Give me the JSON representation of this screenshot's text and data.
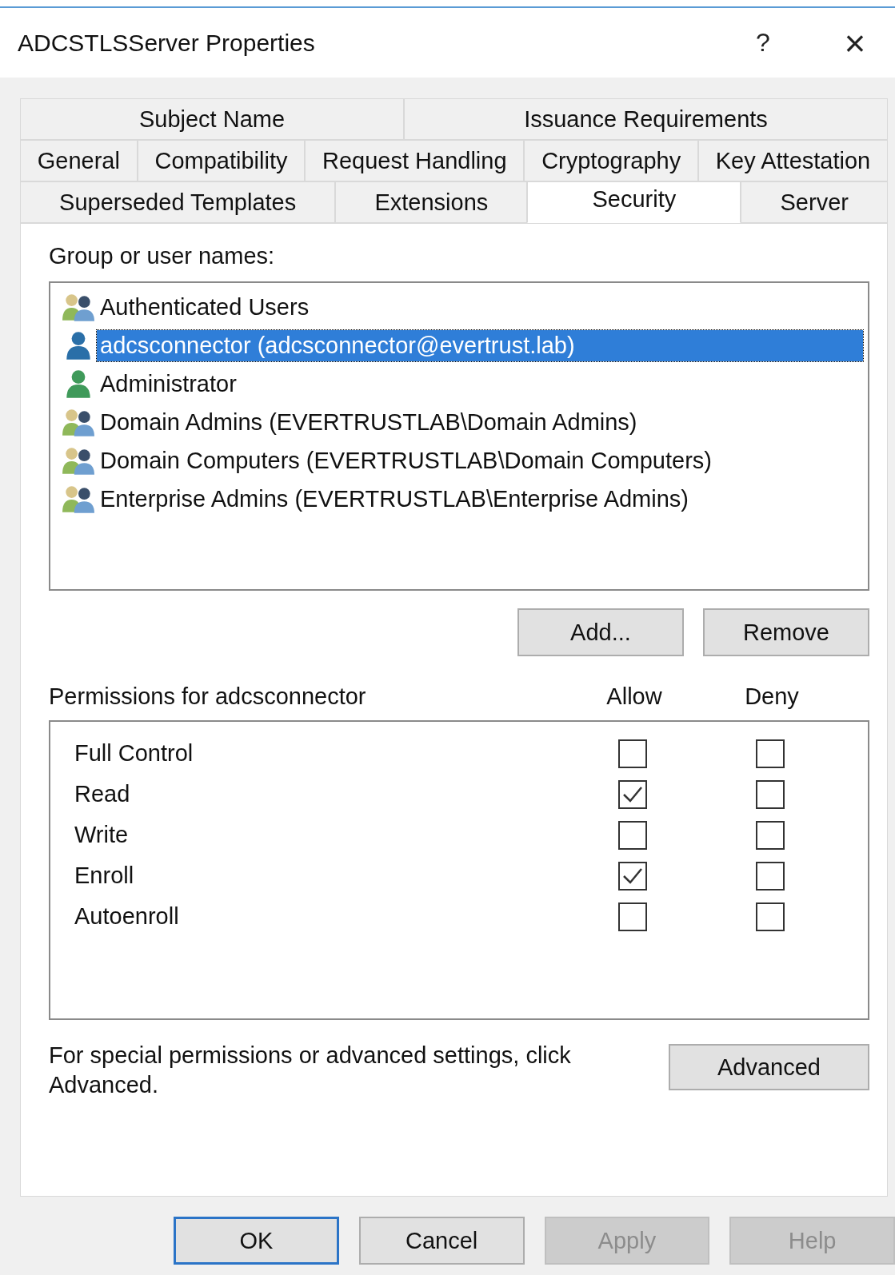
{
  "window": {
    "title": "ADCSTLSServer Properties",
    "help": "?",
    "close": "×"
  },
  "tab_rows": [
    [
      {
        "label": "Subject Name",
        "selected": false
      },
      {
        "label": "Issuance Requirements",
        "selected": false
      }
    ],
    [
      {
        "label": "General",
        "selected": false
      },
      {
        "label": "Compatibility",
        "selected": false
      },
      {
        "label": "Request Handling",
        "selected": false
      },
      {
        "label": "Cryptography",
        "selected": false
      },
      {
        "label": "Key Attestation",
        "selected": false
      }
    ],
    [
      {
        "label": "Superseded Templates",
        "selected": false
      },
      {
        "label": "Extensions",
        "selected": false
      },
      {
        "label": "Security",
        "selected": true
      },
      {
        "label": "Server",
        "selected": false
      }
    ]
  ],
  "group_label": "Group or user names:",
  "principals": [
    {
      "name": "Authenticated Users",
      "kind": "group",
      "selected": false
    },
    {
      "name": "adcsconnector (adcsconnector@evertrust.lab)",
      "kind": "user",
      "color": "#2a6fa8",
      "selected": true
    },
    {
      "name": "Administrator",
      "kind": "user",
      "color": "#3f9a5a",
      "selected": false
    },
    {
      "name": "Domain Admins (EVERTRUSTLAB\\Domain Admins)",
      "kind": "group",
      "selected": false
    },
    {
      "name": "Domain Computers (EVERTRUSTLAB\\Domain Computers)",
      "kind": "group",
      "selected": false
    },
    {
      "name": "Enterprise Admins (EVERTRUSTLAB\\Enterprise Admins)",
      "kind": "group",
      "selected": false
    }
  ],
  "principal_buttons": [
    "Add...",
    "Remove"
  ],
  "permissions": {
    "title": "Permissions for adcsconnector",
    "allow_label": "Allow",
    "deny_label": "Deny",
    "rows": [
      {
        "name": "Full Control",
        "allow": false,
        "deny": false
      },
      {
        "name": "Read",
        "allow": true,
        "deny": false
      },
      {
        "name": "Write",
        "allow": false,
        "deny": false
      },
      {
        "name": "Enroll",
        "allow": true,
        "deny": false
      },
      {
        "name": "Autoenroll",
        "allow": false,
        "deny": false
      }
    ]
  },
  "advanced_text": "For special permissions or advanced settings, click Advanced.",
  "advanced_button": "Advanced",
  "buttons": [
    {
      "label": "OK",
      "default": true,
      "disabled": false
    },
    {
      "label": "Cancel",
      "default": false,
      "disabled": false
    },
    {
      "label": "Apply",
      "default": false,
      "disabled": true
    },
    {
      "label": "Help",
      "default": false,
      "disabled": true
    }
  ]
}
